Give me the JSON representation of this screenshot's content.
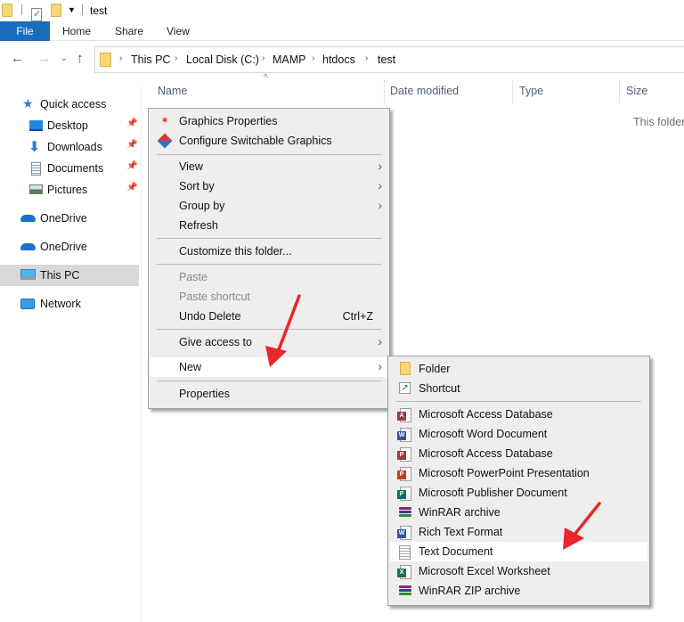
{
  "window": {
    "title": "test",
    "quick_access_toolbar": [
      "folder-icon",
      "properties-icon",
      "new-folder-icon",
      "customize-dropdown-icon"
    ]
  },
  "ribbon": {
    "tabs": [
      {
        "label": "File",
        "active": true
      },
      {
        "label": "Home"
      },
      {
        "label": "Share"
      },
      {
        "label": "View"
      }
    ],
    "file_tab_color": "#1a6cbc"
  },
  "address_bar": {
    "back_icon": "arrow-left-icon",
    "forward_icon": "arrow-right-icon",
    "recent_icon": "chevron-down-icon",
    "up_icon": "arrow-up-icon",
    "breadcrumb": [
      "This PC",
      "Local Disk (C:)",
      "MAMP",
      "htdocs",
      "test"
    ]
  },
  "sidebar": {
    "items": [
      {
        "label": "Quick access",
        "icon": "star-icon",
        "pinned": false
      },
      {
        "label": "Desktop",
        "icon": "desktop-icon",
        "pinned": true
      },
      {
        "label": "Downloads",
        "icon": "download-icon",
        "pinned": true
      },
      {
        "label": "Documents",
        "icon": "documents-icon",
        "pinned": true
      },
      {
        "label": "Pictures",
        "icon": "pictures-icon",
        "pinned": true
      },
      {
        "label": "OneDrive",
        "icon": "cloud-icon",
        "pinned": false
      },
      {
        "label": "OneDrive",
        "icon": "cloud-icon",
        "pinned": false
      },
      {
        "label": "This PC",
        "icon": "computer-icon",
        "pinned": false,
        "selected": true
      },
      {
        "label": "Network",
        "icon": "network-icon",
        "pinned": false
      }
    ]
  },
  "file_list": {
    "columns": [
      "Name",
      "Date modified",
      "Type",
      "Size"
    ],
    "sorted_by": "Name",
    "empty_message": "This folder is empty."
  },
  "context_menu": {
    "items": [
      {
        "label": "Graphics Properties",
        "icon": "graphics-properties-icon"
      },
      {
        "label": "Configure Switchable Graphics",
        "icon": "switchable-graphics-icon"
      },
      {
        "separator": true
      },
      {
        "label": "View",
        "submenu": true
      },
      {
        "label": "Sort by",
        "submenu": true
      },
      {
        "label": "Group by",
        "submenu": true
      },
      {
        "label": "Refresh"
      },
      {
        "separator": true
      },
      {
        "label": "Customize this folder..."
      },
      {
        "separator": true
      },
      {
        "label": "Paste",
        "disabled": true
      },
      {
        "label": "Paste shortcut",
        "disabled": true
      },
      {
        "label": "Undo Delete",
        "shortcut": "Ctrl+Z"
      },
      {
        "separator": true
      },
      {
        "label": "Give access to",
        "submenu": true
      },
      {
        "label": "New",
        "submenu": true,
        "highlighted": true
      },
      {
        "separator": true
      },
      {
        "label": "Properties"
      }
    ]
  },
  "new_submenu": {
    "items": [
      {
        "label": "Folder",
        "icon": "folder-icon"
      },
      {
        "label": "Shortcut",
        "icon": "shortcut-icon"
      },
      {
        "separator": true
      },
      {
        "label": "Microsoft Access Database",
        "icon": "access-icon",
        "badge": "A",
        "color": "#a4373a"
      },
      {
        "label": "Microsoft Word Document",
        "icon": "word-icon",
        "badge": "W",
        "color": "#2b579a"
      },
      {
        "label": "Microsoft Access Database",
        "icon": "access-icon",
        "badge": "P",
        "color": "#a4373a"
      },
      {
        "label": "Microsoft PowerPoint Presentation",
        "icon": "powerpoint-icon",
        "badge": "P",
        "color": "#c43e1c"
      },
      {
        "label": "Microsoft Publisher Document",
        "icon": "publisher-icon",
        "badge": "P",
        "color": "#077568"
      },
      {
        "label": "WinRAR archive",
        "icon": "winrar-icon"
      },
      {
        "label": "Rich Text Format",
        "icon": "word-icon",
        "badge": "W",
        "color": "#2b579a"
      },
      {
        "label": "Text Document",
        "icon": "text-document-icon",
        "highlighted": true
      },
      {
        "label": "Microsoft Excel Worksheet",
        "icon": "excel-icon",
        "badge": "X",
        "color": "#217346"
      },
      {
        "label": "WinRAR ZIP archive",
        "icon": "winrar-icon"
      }
    ]
  },
  "annotations": {
    "arrow_color": "#e8262b",
    "arrows": [
      "points-to-New",
      "points-to-Text-Document"
    ]
  }
}
